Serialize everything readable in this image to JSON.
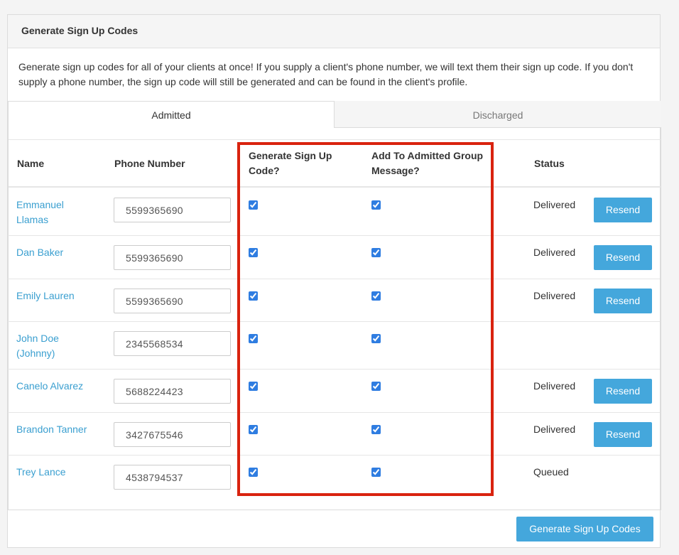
{
  "panel": {
    "title": "Generate Sign Up Codes",
    "intro": "Generate sign up codes for all of your clients at once! If you supply a client's phone number, we will text them their sign up code. If you don't supply a phone number, the sign up code will still be generated and can be found in the client's profile."
  },
  "tabs": [
    {
      "label": "Admitted",
      "active": true
    },
    {
      "label": "Discharged",
      "active": false
    }
  ],
  "table": {
    "headers": {
      "name": "Name",
      "phone": "Phone Number",
      "generate": "Generate Sign Up Code?",
      "group": "Add To Admitted Group Message?",
      "status": "Status"
    },
    "rows": [
      {
        "name": "Emmanuel Llamas",
        "phone": "5599365690",
        "generate": true,
        "group": true,
        "status": "Delivered",
        "action": "Resend"
      },
      {
        "name": "Dan Baker",
        "phone": "5599365690",
        "generate": true,
        "group": true,
        "status": "Delivered",
        "action": "Resend"
      },
      {
        "name": "Emily Lauren",
        "phone": "5599365690",
        "generate": true,
        "group": true,
        "status": "Delivered",
        "action": "Resend"
      },
      {
        "name": "John Doe (Johnny)",
        "phone": "2345568534",
        "generate": true,
        "group": true,
        "status": "",
        "action": ""
      },
      {
        "name": "Canelo Alvarez",
        "phone": "5688224423",
        "generate": true,
        "group": true,
        "status": "Delivered",
        "action": "Resend"
      },
      {
        "name": "Brandon Tanner",
        "phone": "3427675546",
        "generate": true,
        "group": true,
        "status": "Delivered",
        "action": "Resend"
      },
      {
        "name": "Trey Lance",
        "phone": "4538794537",
        "generate": true,
        "group": true,
        "status": "Queued",
        "action": ""
      }
    ]
  },
  "footer": {
    "generate_button": "Generate Sign Up Codes"
  },
  "colors": {
    "accent": "#44a7dc",
    "link": "#3a9fd0",
    "highlight": "#d9230f"
  }
}
